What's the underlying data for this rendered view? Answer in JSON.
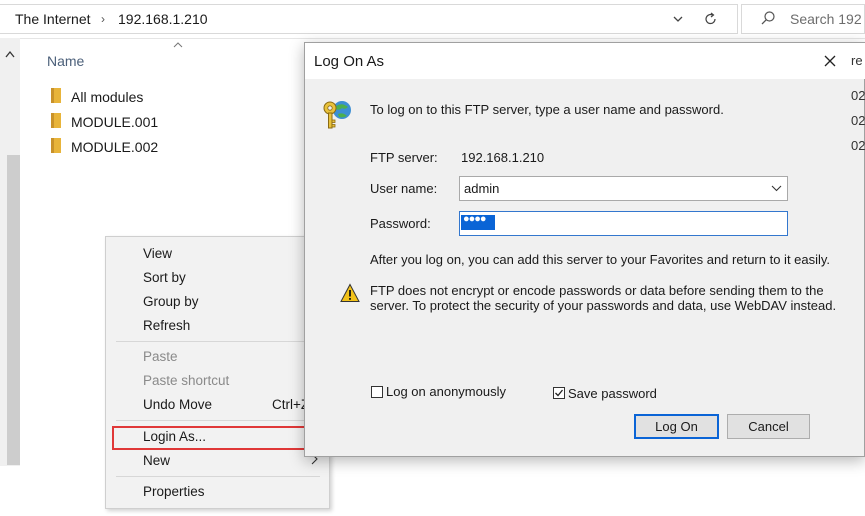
{
  "address_bar": {
    "root": "The Internet",
    "separator": "›",
    "host": "192.168.1.210",
    "search_placeholder": "Search 192"
  },
  "file_list": {
    "column_name": "Name",
    "items": [
      {
        "name": "All modules"
      },
      {
        "name": "MODULE.001"
      },
      {
        "name": "MODULE.002"
      }
    ],
    "date_clips": [
      "re",
      "02",
      "02",
      "02"
    ]
  },
  "context_menu": {
    "view": "View",
    "sort_by": "Sort by",
    "group_by": "Group by",
    "refresh": "Refresh",
    "paste": "Paste",
    "paste_shortcut": "Paste shortcut",
    "undo_move": "Undo Move",
    "undo_shortcut": "Ctrl+Z",
    "login_as": "Login As...",
    "new": "New",
    "properties": "Properties"
  },
  "dialog": {
    "title": "Log On As",
    "intro": "To log on to this FTP server, type a user name and password.",
    "ftp_server_label": "FTP server:",
    "ftp_server_value": "192.168.1.210",
    "user_name_label": "User name:",
    "user_name_value": "admin",
    "password_label": "Password:",
    "password_value": "●●●●",
    "after_note": "After you log on, you can add this server to your Favorites and return to it easily.",
    "warning_line1": "FTP does not encrypt or encode passwords or data before sending them to the",
    "warning_line2": "server.  To protect the security of your passwords and data, use WebDAV instead.",
    "log_on_anonymously": "Log on anonymously",
    "log_on_anonymously_checked": false,
    "save_password": "Save password",
    "save_password_checked": true,
    "log_on_button": "Log On",
    "cancel_button": "Cancel"
  },
  "colors": {
    "accent": "#0a64d6",
    "highlight_box": "#e03838",
    "folder": "#e8b43a",
    "warning": "#f2c21a"
  },
  "icons": [
    "chevron-down-icon",
    "refresh-icon",
    "search-icon",
    "folder-icon",
    "close-icon",
    "key-globe-icon",
    "warning-icon",
    "check-icon",
    "chevron-right-icon"
  ]
}
